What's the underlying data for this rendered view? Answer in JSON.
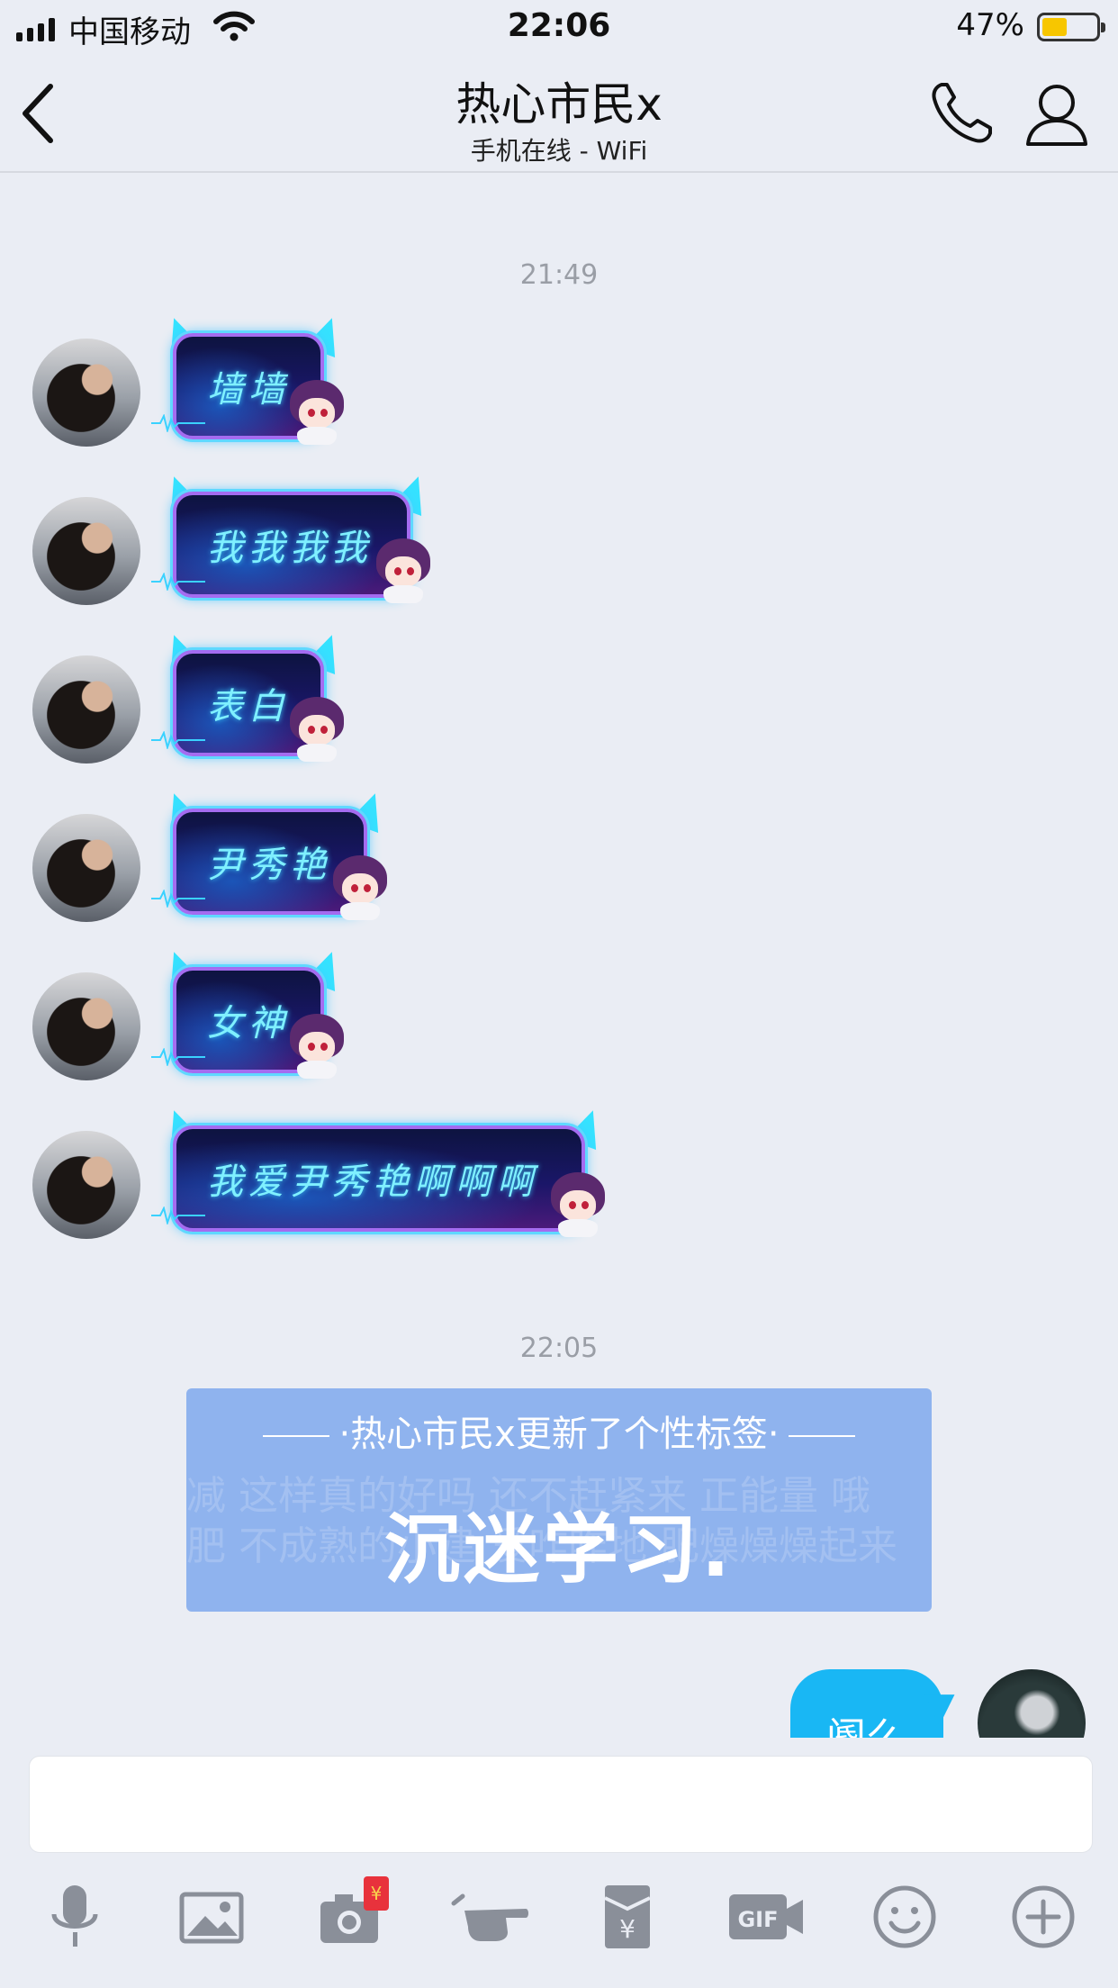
{
  "status_bar": {
    "carrier": "中国移动",
    "time": "22:06",
    "battery_percent": "47%",
    "battery_level": 0.47,
    "battery_color": "#f7c600"
  },
  "nav": {
    "back_icon": "chevron-left-icon",
    "title": "热心市民x",
    "subtitle": "手机在线 - WiFi",
    "actions": [
      "phone-icon",
      "profile-icon"
    ]
  },
  "chat": {
    "time_1": "21:49",
    "incoming_messages": [
      {
        "text": "墙墙"
      },
      {
        "text": "我我我我"
      },
      {
        "text": "表白"
      },
      {
        "text": "尹秀艳"
      },
      {
        "text": "女神"
      },
      {
        "text": "我爱尹秀艳啊啊啊"
      }
    ],
    "time_2": "22:05",
    "signature_card": {
      "header": "热心市民x更新了个性标签",
      "signature": "沉迷学习.",
      "background_text_1": "减 这样真的好吗 还不赶紧来 正能量 哦",
      "background_text_2": "肥 不成熟的小建 爱咋咋地 肥燥燥燥起来"
    },
    "outgoing_message": "阍么",
    "bubble_color": "#19b7f4",
    "card_color": "#8fb3ee"
  },
  "input": {
    "value": ""
  },
  "toolbar": {
    "items": [
      "microphone-icon",
      "image-icon",
      "camera-icon",
      "poke-icon",
      "red-packet-icon",
      "gif-icon",
      "emoji-icon",
      "plus-icon"
    ],
    "camera_badge": "¥"
  }
}
